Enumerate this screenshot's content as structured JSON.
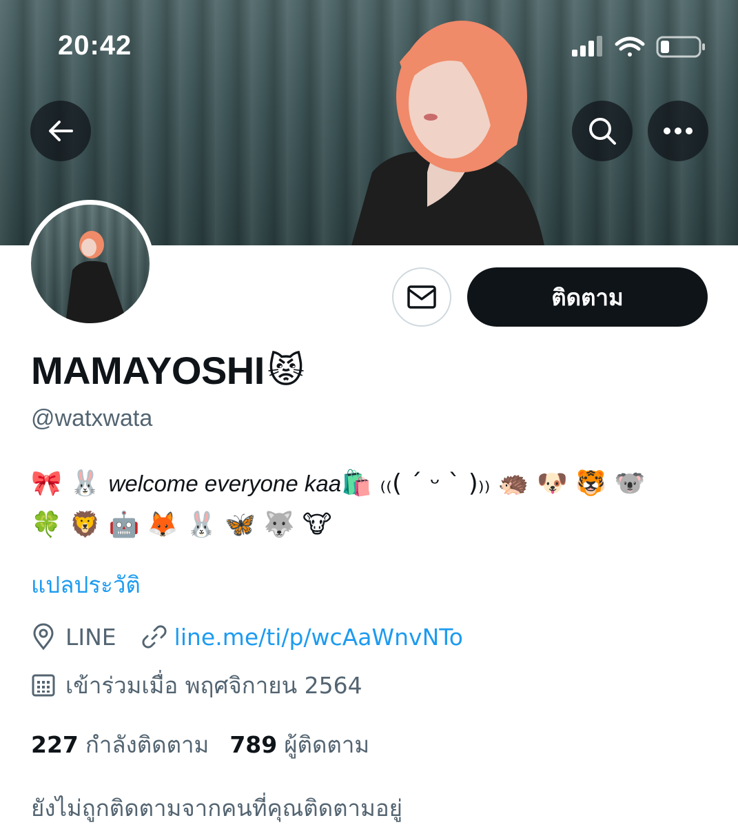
{
  "status_bar": {
    "time": "20:42",
    "signal_icon": "cellular-signal-icon",
    "wifi_icon": "wifi-icon",
    "battery_icon": "battery-low-icon"
  },
  "header": {
    "back_icon": "back-arrow-icon",
    "search_icon": "search-icon",
    "more_icon": "more-options-icon"
  },
  "actions": {
    "message_icon": "mail-icon",
    "follow_label": "ติดตาม"
  },
  "profile": {
    "display_name": "MAMAYOSHI",
    "name_emoji": "😾",
    "handle": "@watxwata",
    "bio_prefix": "🎀 🐰 ",
    "bio_text": "welcome everyone kaa",
    "bio_suffix": "🛍️ ₍₍( ˊ ᵕ ˋ )₎₎ 🦔 🐶 🐯 🐨",
    "bio_line2": "🍀 🦁 🤖 🦊 🐰 🦋 🐺 🐮",
    "translate_label": "แปลประวัติ",
    "location": "LINE",
    "location_icon": "location-pin-icon",
    "link_icon": "link-icon",
    "website": "line.me/ti/p/wcAaWnvNTo",
    "calendar_icon": "calendar-icon",
    "joined": "เข้าร่วมเมื่อ พฤศจิกายน 2564",
    "following_count": "227",
    "following_label": "กำลังติดตาม",
    "followers_count": "789",
    "followers_label": "ผู้ติดตาม",
    "not_followed_note": "ยังไม่ถูกติดตามจากคนที่คุณติดตามอยู่"
  },
  "colors": {
    "accent": "#1d9bf0",
    "text_primary": "#0f1419",
    "text_secondary": "#536471",
    "follow_button_bg": "#0f1419"
  }
}
